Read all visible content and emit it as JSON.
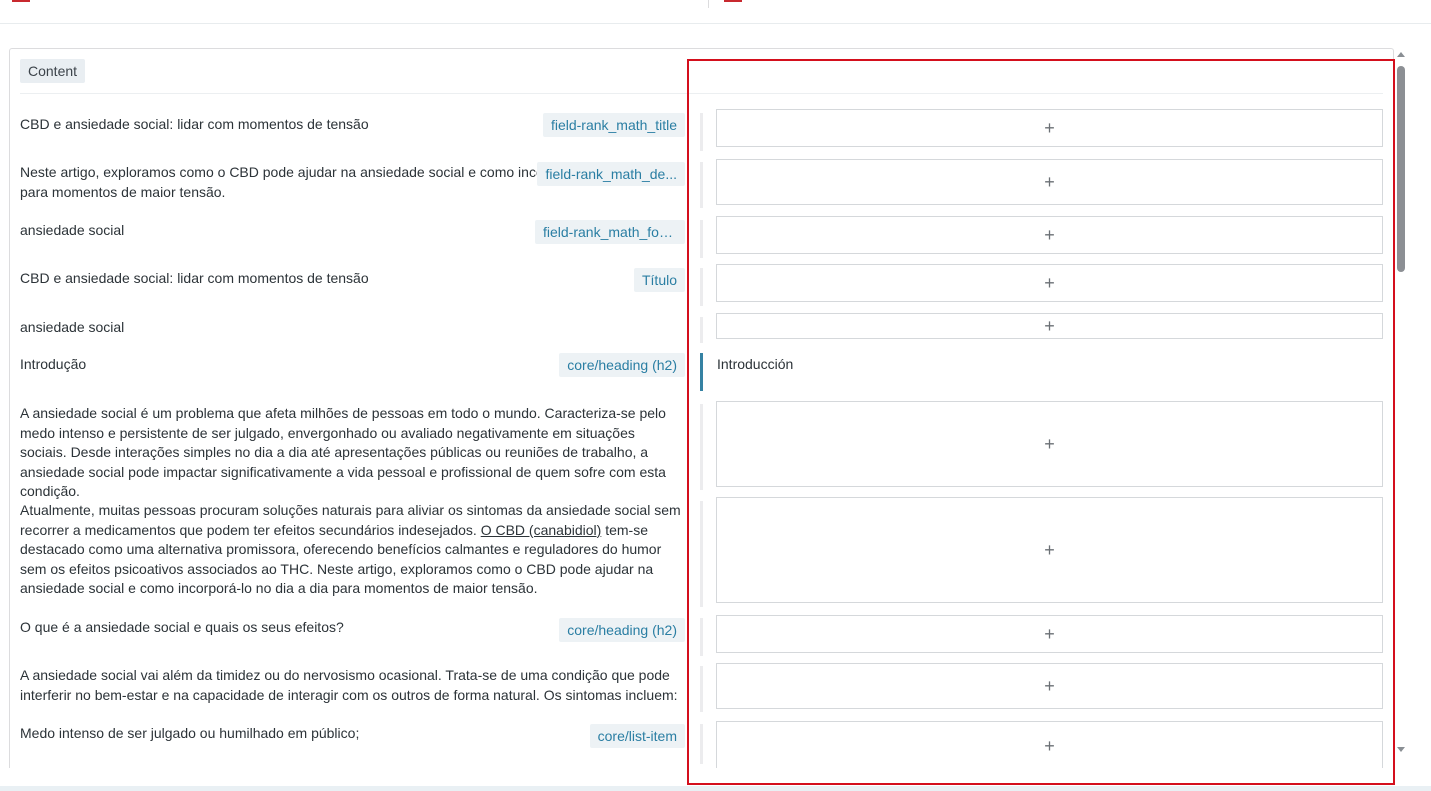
{
  "header": {
    "section_tag": "Content"
  },
  "rows": [
    {
      "source": "CBD e ansiedade social: lidar com momentos de tensão",
      "tag": "field-rank_math_title",
      "translation": ""
    },
    {
      "source": "Neste artigo, exploramos como o CBD pode ajudar na ansiedade social e como incorporá-lo no dia a dia para momentos de maior tensão.",
      "tag": "field-rank_math_de...",
      "translation": ""
    },
    {
      "source": "ansiedade social",
      "tag": "field-rank_math_foc...",
      "translation": ""
    },
    {
      "source": "CBD e ansiedade social: lidar com momentos de tensão",
      "tag": "Título",
      "translation": ""
    },
    {
      "source": "ansiedade social",
      "tag": "",
      "translation": ""
    },
    {
      "source": "Introdução",
      "tag": "core/heading (h2)",
      "translation": "Introducción"
    },
    {
      "source": "A ansiedade social é um problema que afeta milhões de pessoas em todo o mundo. Caracteriza-se pelo medo intenso e persistente de ser julgado, envergonhado ou avaliado negativamente em situações sociais. Desde interações simples no dia a dia até apresentações públicas ou reuniões de trabalho, a ansiedade social pode impactar significativamente a vida pessoal e profissional de quem sofre com esta condição.",
      "tag": "",
      "translation": ""
    },
    {
      "source_before": "Atualmente, muitas pessoas procuram soluções naturais para aliviar os sintomas da ansiedade social sem recorrer a medicamentos que podem ter efeitos secundários indesejados. ",
      "source_link": "O CBD (canabidiol)",
      "source_after": " tem-se destacado como uma alternativa promissora, oferecendo benefícios calmantes e reguladores do humor sem os efeitos psicoativos associados ao THC. Neste artigo, exploramos como o CBD pode ajudar na ansiedade social e como incorporá-lo no dia a dia para momentos de maior tensão.",
      "tag": "",
      "translation": ""
    },
    {
      "source": "O que é a ansiedade social e quais os seus efeitos?",
      "tag": "core/heading (h2)",
      "translation": ""
    },
    {
      "source": "A ansiedade social vai além da timidez ou do nervosismo ocasional. Trata-se de uma condição que pode interferir no bem-estar e na capacidade de interagir com os outros de forma natural. Os sintomas incluem:",
      "tag": "",
      "translation": ""
    },
    {
      "source": "Medo intenso de ser julgado ou humilhado em público;",
      "tag": "core/list-item",
      "translation": ""
    }
  ],
  "icons": {
    "add": "plus-icon",
    "scroll_up": "triangle-up-icon",
    "scroll_down": "triangle-down-icon",
    "language_flag": "flag-icon"
  },
  "colors": {
    "accent": "#2a7ea3",
    "active_separator": "#3582a3",
    "highlight": "#d40f1d",
    "flag": "#c8292f"
  }
}
